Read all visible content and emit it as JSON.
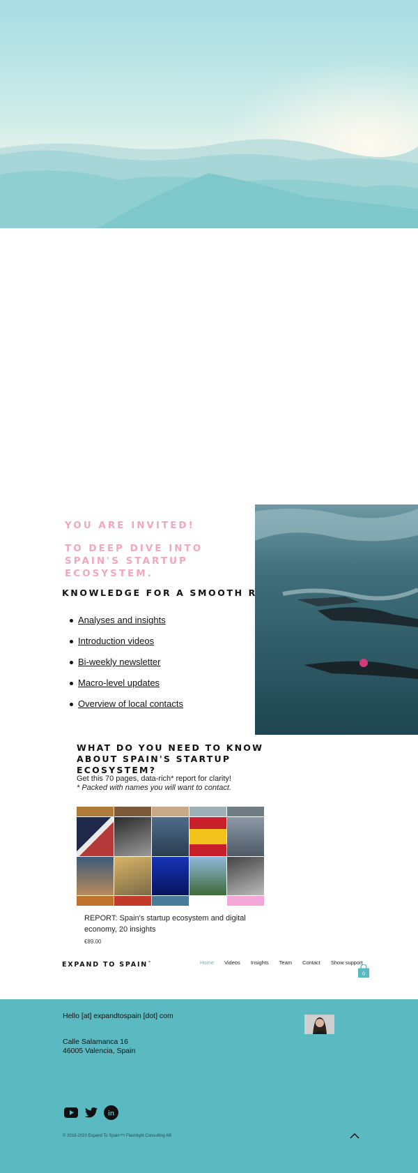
{
  "invite": {
    "line1": "YOU ARE INVITED!",
    "line2": "TO DEEP DIVE INTO SPAIN'S STARTUP ECOSYSTEM."
  },
  "knowledge": {
    "heading": "KNOWLEDGE FOR A SMOOTH RIDE:",
    "items": [
      "Analyses and insights",
      "Introduction videos",
      "Bi-weekly newsletter",
      "Macro-level updates",
      "Overview of local contacts"
    ]
  },
  "report": {
    "heading": "WHAT DO YOU NEED TO KNOW ABOUT SPAIN'S STARTUP ECOSYSTEM?",
    "description": "Get this 70 pages, data-rich* report for clarity!",
    "note": "* Packed with names you will want to contact.",
    "product_title": "REPORT: Spain's startup ecosystem and digital economy, 20 insights",
    "product_price": "€89,00"
  },
  "header": {
    "brand": "EXPAND TO SPAIN",
    "brand_mark": "™",
    "nav": [
      "Home",
      "Videos",
      "Insights",
      "Team",
      "Contact",
      "Show support"
    ],
    "active_nav": "Home",
    "cart_count": "0"
  },
  "footer": {
    "email": "Hello [at] expandtospain [dot] com",
    "address_line1": "Calle Salamanca 16",
    "address_line2": "46005 Valencia, Spain",
    "copyright": "© 2018-2020 Expand To Spain™/ Flashlight Consulting AB",
    "social": [
      "youtube-icon",
      "twitter-icon",
      "linkedin-icon"
    ]
  },
  "colors": {
    "accent": "#5bb9c1",
    "invite_pink": "#f2a7bf",
    "footer_bg": "#5bb9c1"
  }
}
